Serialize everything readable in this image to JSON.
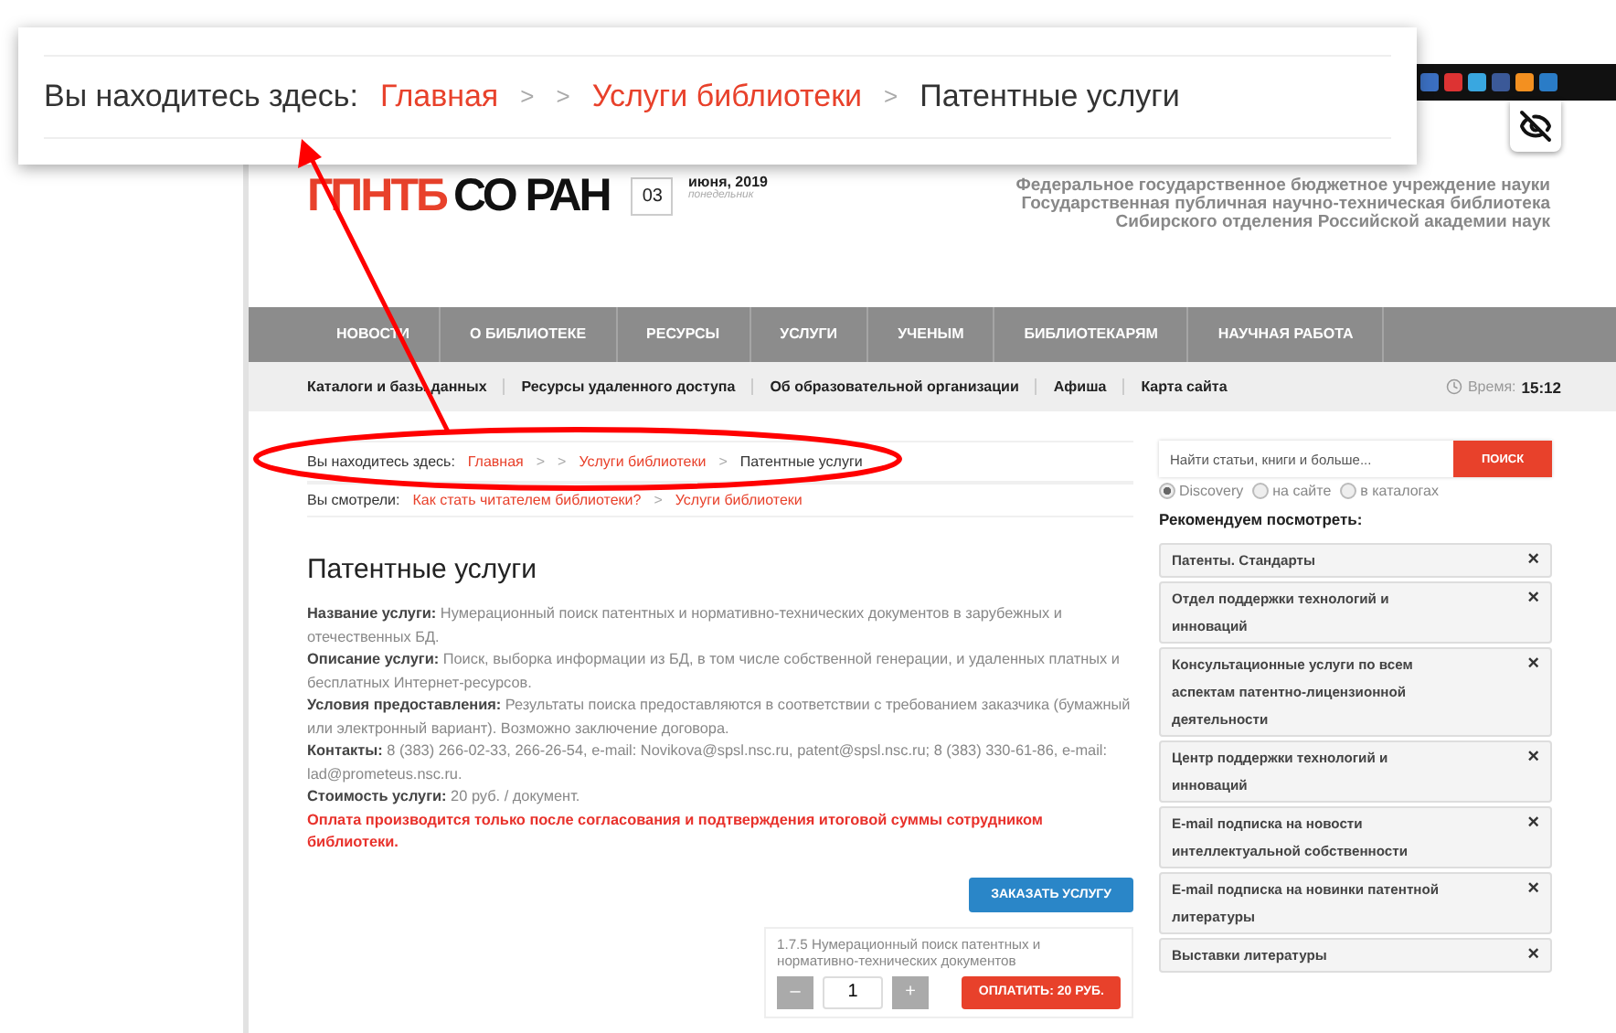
{
  "callout": {
    "label": "Вы находитесь здесь:",
    "crumbs": [
      {
        "kind": "link",
        "text": "Главная"
      },
      {
        "kind": "separator",
        "text": ">"
      },
      {
        "kind": "separator",
        "text": ">"
      },
      {
        "kind": "link",
        "text": "Услуги библиотеки"
      },
      {
        "kind": "separator",
        "text": ">"
      },
      {
        "kind": "current",
        "text": "Патентные услуги"
      }
    ]
  },
  "header": {
    "logo_accent": "ГПНТБ",
    "logo_rest": "СО РАН",
    "day": "03",
    "month_year": "июня, 2019",
    "weekday": "понедельник",
    "org_lines": [
      "Федеральное государственное бюджетное учреждение науки",
      "Государственная публичная научно-техническая библиотека",
      "Сибирского отделения Российской академии наук"
    ]
  },
  "nav": [
    "НОВОСТИ",
    "О БИБЛИОТЕКЕ",
    "РЕСУРСЫ",
    "УСЛУГИ",
    "УЧЕНЫМ",
    "БИБЛИОТЕКАРЯМ",
    "НАУЧНАЯ РАБОТА"
  ],
  "subnav": {
    "items": [
      "Каталоги и базы данных",
      "Ресурсы удаленного доступа",
      "Об образовательной организации",
      "Афиша",
      "Карта сайта"
    ],
    "time_label": "Время:",
    "time": "15:12"
  },
  "breadcrumb": {
    "label": "Вы находитесь здесь:",
    "crumbs": [
      {
        "kind": "link",
        "text": "Главная"
      },
      {
        "kind": "separator",
        "text": ">"
      },
      {
        "kind": "separator",
        "text": ">"
      },
      {
        "kind": "link",
        "text": "Услуги библиотеки"
      },
      {
        "kind": "separator",
        "text": ">"
      },
      {
        "kind": "current",
        "text": "Патентные услуги"
      }
    ]
  },
  "viewed": {
    "label": "Вы смотрели:",
    "crumbs": [
      {
        "kind": "link",
        "text": "Как стать читателем библиотеки?"
      },
      {
        "kind": "separator",
        "text": ">"
      },
      {
        "kind": "link",
        "text": "Услуги библиотеки"
      }
    ]
  },
  "title": "Патентные услуги",
  "fields": [
    "**Название услуги:** Нумерационный поиск патентных и нормативно-технических документов в зарубежных и отечественных БД.",
    "**Описание услуги:** Поиск, выборка информации из БД, в том числе собственной генерации, и удаленных платных и бесплатных Интернет-ресурсов.",
    "**Условия предоставления:** Результаты поиска предоставляются в соответствии с требованием заказчика (бумажный или электронный вариант). Возможно заключение договора.",
    "**Контакты:** 8 (383) 266-02-33, 266-26-54, e-mail: Novikova@spsl.nsc.ru, patent@spsl.nsc.ru; 8 (383) 330-61-86, e-mail: lad@prometeus.nsc.ru.",
    "**Стоимость услуги:** 20 руб. / документ."
  ],
  "notice": "Оплата производится только после согласования и подтверждения итоговой суммы сотрудником библиотеки.",
  "order_button": "ЗАКАЗАТЬ УСЛУГУ",
  "cart": {
    "name": "1.7.5 Нумерационный поиск патентных и нормативно-технических документов",
    "minus": "–",
    "quantity": "1",
    "plus": "+",
    "pay": "ОПЛАТИТЬ: 20 РУБ."
  },
  "search": {
    "placeholder": "Найти статьи, книги и больше...",
    "button": "ПОИСК",
    "scopes": [
      {
        "label": "Discovery",
        "selected": true
      },
      {
        "label": "на сайте",
        "selected": false
      },
      {
        "label": "в каталогах",
        "selected": false
      }
    ]
  },
  "recommend": {
    "title": "Рекомендуем посмотреть:",
    "items": [
      {
        "text": "Патенты. Стандарты",
        "close": "×"
      },
      {
        "text": "Отдел поддержки технологий и инноваций",
        "close": "×"
      },
      {
        "text": "Консультационные услуги по всем аспектам патентно-лицензионной деятельности",
        "close": "×"
      },
      {
        "text": "Центр поддержки технологий и инноваций",
        "close": "×"
      },
      {
        "text": "E-mail подписка на новости интеллектуальной собственности",
        "close": "×"
      },
      {
        "text": "E-mail подписка на новинки патентной литературы",
        "close": "×"
      },
      {
        "text": "Выставки литературы",
        "close": "×"
      }
    ]
  }
}
